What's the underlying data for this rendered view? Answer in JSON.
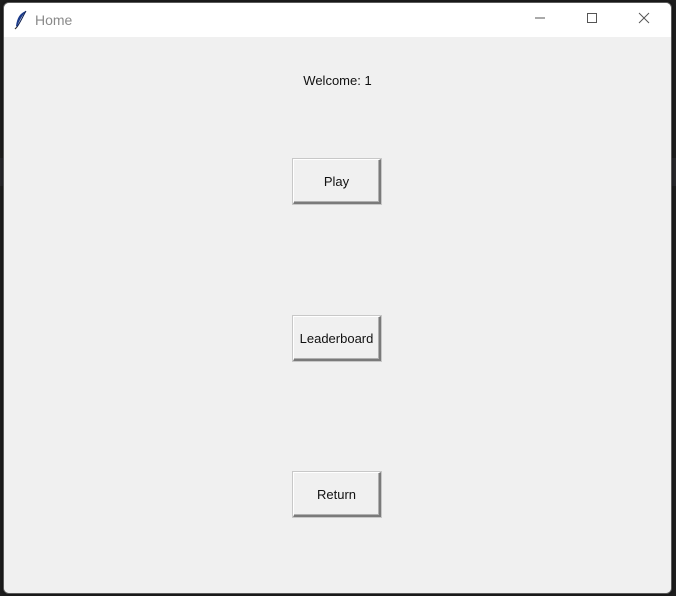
{
  "window": {
    "title": "Home",
    "icon": "feather-icon",
    "controls": {
      "minimize": "minimize-icon",
      "maximize": "maximize-icon",
      "close": "close-icon"
    }
  },
  "main": {
    "welcome_text": "Welcome: 1",
    "buttons": [
      {
        "label": "Play"
      },
      {
        "label": "Leaderboard"
      },
      {
        "label": "Return"
      }
    ]
  },
  "colors": {
    "window_bg": "#f0f0f0",
    "titlebar_bg": "#ffffff",
    "title_text": "#8a8a8a"
  }
}
